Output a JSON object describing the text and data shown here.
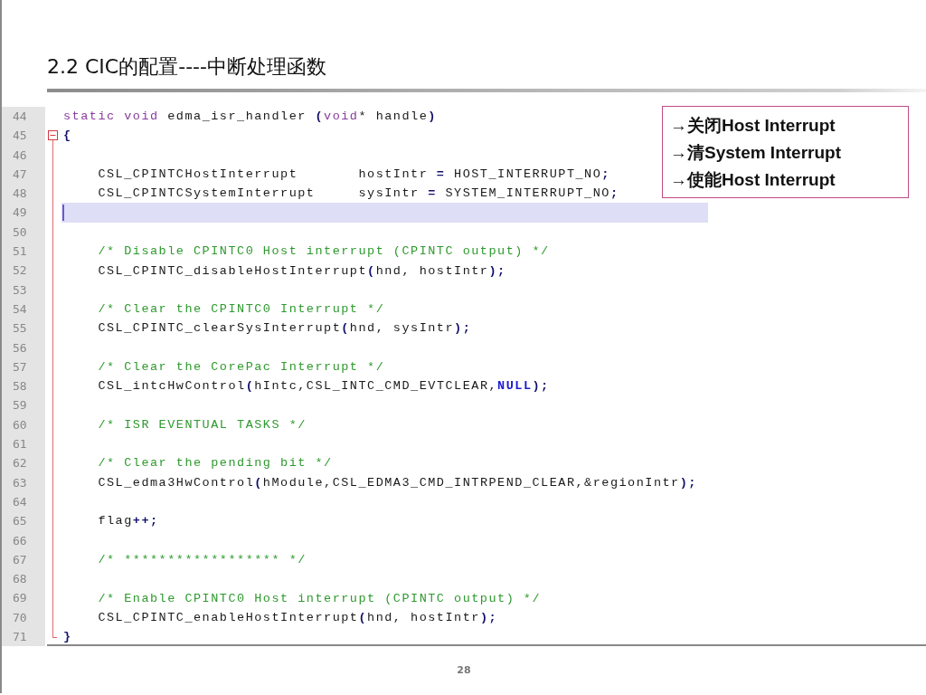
{
  "slide": {
    "title": "2.2 CIC的配置----中断处理函数",
    "page_number": "28"
  },
  "editor": {
    "lines": [
      {
        "number": "44",
        "kind": "plain",
        "current": false,
        "segments": [
          {
            "kind": "keyword",
            "text": "static void"
          },
          {
            "kind": "plain",
            "text": " edma_isr_handler "
          },
          {
            "kind": "punct",
            "text": "("
          },
          {
            "kind": "keyword",
            "text": "void"
          },
          {
            "kind": "plain",
            "text": "* handle"
          },
          {
            "kind": "punct",
            "text": ")"
          }
        ]
      },
      {
        "number": "45",
        "kind": "fold-start",
        "current": false,
        "segments": [
          {
            "kind": "punct",
            "text": "{"
          }
        ]
      },
      {
        "number": "46",
        "kind": "fold-body",
        "current": false
      },
      {
        "number": "47",
        "kind": "fold-body",
        "current": false,
        "segments": [
          {
            "kind": "plain",
            "text": "    CSL_CPINTCHostInterrupt       hostIntr "
          },
          {
            "kind": "punct",
            "text": "="
          },
          {
            "kind": "plain",
            "text": " HOST_INTERRUPT_NO"
          },
          {
            "kind": "punct",
            "text": ";"
          }
        ]
      },
      {
        "number": "48",
        "kind": "fold-body",
        "current": false,
        "segments": [
          {
            "kind": "plain",
            "text": "    CSL_CPINTCSystemInterrupt     sysIntr "
          },
          {
            "kind": "punct",
            "text": "="
          },
          {
            "kind": "plain",
            "text": " SYSTEM_INTERRUPT_NO"
          },
          {
            "kind": "punct",
            "text": ";"
          }
        ]
      },
      {
        "number": "49",
        "kind": "fold-body",
        "current": true
      },
      {
        "number": "50",
        "kind": "fold-body",
        "current": false
      },
      {
        "number": "51",
        "kind": "fold-body",
        "current": false,
        "segments": [
          {
            "kind": "comment",
            "text": "    /* Disable CPINTC0 Host interrupt (CPINTC output) */"
          }
        ]
      },
      {
        "number": "52",
        "kind": "fold-body",
        "current": false,
        "segments": [
          {
            "kind": "plain",
            "text": "    CSL_CPINTC_disableHostInterrupt"
          },
          {
            "kind": "punct",
            "text": "("
          },
          {
            "kind": "plain",
            "text": "hnd, hostIntr"
          },
          {
            "kind": "punct",
            "text": ");"
          }
        ]
      },
      {
        "number": "53",
        "kind": "fold-body",
        "current": false
      },
      {
        "number": "54",
        "kind": "fold-body",
        "current": false,
        "segments": [
          {
            "kind": "comment",
            "text": "    /* Clear the CPINTC0 Interrupt */"
          }
        ]
      },
      {
        "number": "55",
        "kind": "fold-body",
        "current": false,
        "segments": [
          {
            "kind": "plain",
            "text": "    CSL_CPINTC_clearSysInterrupt"
          },
          {
            "kind": "punct",
            "text": "("
          },
          {
            "kind": "plain",
            "text": "hnd, sysIntr"
          },
          {
            "kind": "punct",
            "text": ");"
          }
        ]
      },
      {
        "number": "56",
        "kind": "fold-body",
        "current": false
      },
      {
        "number": "57",
        "kind": "fold-body",
        "current": false,
        "segments": [
          {
            "kind": "comment",
            "text": "    /* Clear the CorePac Interrupt */"
          }
        ]
      },
      {
        "number": "58",
        "kind": "fold-body",
        "current": false,
        "segments": [
          {
            "kind": "plain",
            "text": "    CSL_intcHwControl"
          },
          {
            "kind": "punct",
            "text": "("
          },
          {
            "kind": "plain",
            "text": "hIntc,CSL_INTC_CMD_EVTCLEAR,"
          },
          {
            "kind": "constant",
            "text": "NULL"
          },
          {
            "kind": "punct",
            "text": ");"
          }
        ]
      },
      {
        "number": "59",
        "kind": "fold-body",
        "current": false
      },
      {
        "number": "60",
        "kind": "fold-body",
        "current": false,
        "segments": [
          {
            "kind": "comment",
            "text": "    /* ISR EVENTUAL TASKS */"
          }
        ]
      },
      {
        "number": "61",
        "kind": "fold-body",
        "current": false
      },
      {
        "number": "62",
        "kind": "fold-body",
        "current": false,
        "segments": [
          {
            "kind": "comment",
            "text": "    /* Clear the pending bit */"
          }
        ]
      },
      {
        "number": "63",
        "kind": "fold-body",
        "current": false,
        "segments": [
          {
            "kind": "plain",
            "text": "    CSL_edma3HwControl"
          },
          {
            "kind": "punct",
            "text": "("
          },
          {
            "kind": "plain",
            "text": "hModule,CSL_EDMA3_CMD_INTRPEND_CLEAR,&regionIntr"
          },
          {
            "kind": "punct",
            "text": ");"
          }
        ]
      },
      {
        "number": "64",
        "kind": "fold-body",
        "current": false
      },
      {
        "number": "65",
        "kind": "fold-body",
        "current": false,
        "segments": [
          {
            "kind": "plain",
            "text": "    flag"
          },
          {
            "kind": "punct",
            "text": "++;"
          }
        ]
      },
      {
        "number": "66",
        "kind": "fold-body",
        "current": false
      },
      {
        "number": "67",
        "kind": "fold-body",
        "current": false,
        "segments": [
          {
            "kind": "comment",
            "text": "    /* ****************** */"
          }
        ]
      },
      {
        "number": "68",
        "kind": "fold-body",
        "current": false
      },
      {
        "number": "69",
        "kind": "fold-body",
        "current": false,
        "segments": [
          {
            "kind": "comment",
            "text": "    /* Enable CPINTC0 Host interrupt (CPINTC output) */"
          }
        ]
      },
      {
        "number": "70",
        "kind": "fold-body",
        "current": false,
        "segments": [
          {
            "kind": "plain",
            "text": "    CSL_CPINTC_enableHostInterrupt"
          },
          {
            "kind": "punct",
            "text": "("
          },
          {
            "kind": "plain",
            "text": "hnd, hostIntr"
          },
          {
            "kind": "punct",
            "text": ");"
          }
        ]
      },
      {
        "number": "71",
        "kind": "fold-end",
        "current": false,
        "segments": [
          {
            "kind": "punct",
            "text": "}"
          }
        ]
      }
    ]
  },
  "callout": {
    "lines": [
      "→关闭Host Interrupt",
      "→清System Interrupt",
      "→使能Host Interrupt"
    ]
  }
}
